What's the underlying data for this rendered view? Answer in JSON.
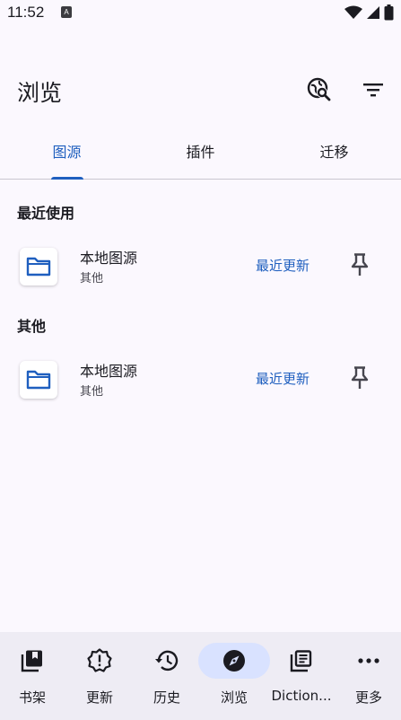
{
  "status_bar": {
    "time": "11:52",
    "notif_glyph": "A"
  },
  "app_bar": {
    "title": "浏览",
    "actions": [
      "global-search-icon",
      "filter-icon"
    ]
  },
  "tabs": [
    {
      "label": "图源",
      "active": true
    },
    {
      "label": "插件",
      "active": false
    },
    {
      "label": "迁移",
      "active": false
    }
  ],
  "sections": [
    {
      "header": "最近使用",
      "items": [
        {
          "name": "本地图源",
          "lang": "其他",
          "latest": "最近更新"
        }
      ]
    },
    {
      "header": "其他",
      "items": [
        {
          "name": "本地图源",
          "lang": "其他",
          "latest": "最近更新"
        }
      ]
    }
  ],
  "bottom_nav": [
    {
      "label": "书架",
      "icon": "library-icon"
    },
    {
      "label": "更新",
      "icon": "updates-icon"
    },
    {
      "label": "历史",
      "icon": "history-icon"
    },
    {
      "label": "浏览",
      "icon": "explore-icon",
      "active": true
    },
    {
      "label": "Diction...",
      "icon": "dictionary-icon"
    },
    {
      "label": "更多",
      "icon": "more-icon"
    }
  ],
  "colors": {
    "accent": "#1f5fbf",
    "background": "#fbf8fe",
    "nav_background": "#eeecf4",
    "active_pill": "#d9e2ff"
  }
}
